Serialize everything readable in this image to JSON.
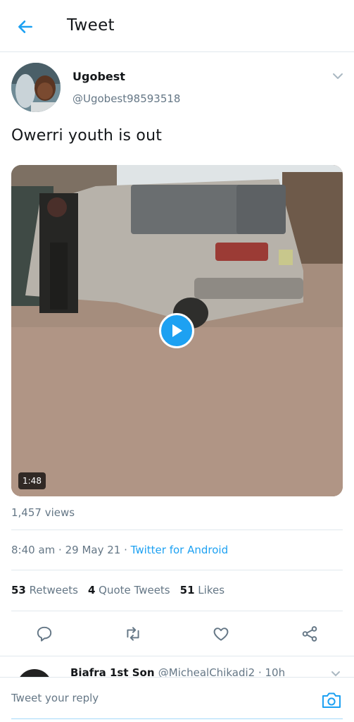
{
  "header": {
    "title": "Tweet",
    "back_icon": "arrow-left-icon",
    "accent": "#1da1f2"
  },
  "tweet": {
    "author_name": "Ugobest",
    "author_handle": "@Ugobest98593518",
    "text": "Owerri youth is out",
    "video": {
      "duration": "1:48",
      "play_icon": "play-icon"
    },
    "views": "1,457 views",
    "time": "8:40 am",
    "date": "29 May 21",
    "source": "Twitter for Android",
    "stats": {
      "retweets_count": "53",
      "retweets_label": "Retweets",
      "quotes_count": "4",
      "quotes_label": "Quote Tweets",
      "likes_count": "51",
      "likes_label": "Likes"
    },
    "actions": [
      "reply-icon",
      "retweet-icon",
      "like-icon",
      "share-icon"
    ]
  },
  "reply_preview": {
    "name": "Biafra 1st Son",
    "handle": "@MichealChikadi2",
    "time": "10h"
  },
  "composer": {
    "placeholder": "Tweet your reply",
    "camera_icon": "camera-icon"
  }
}
